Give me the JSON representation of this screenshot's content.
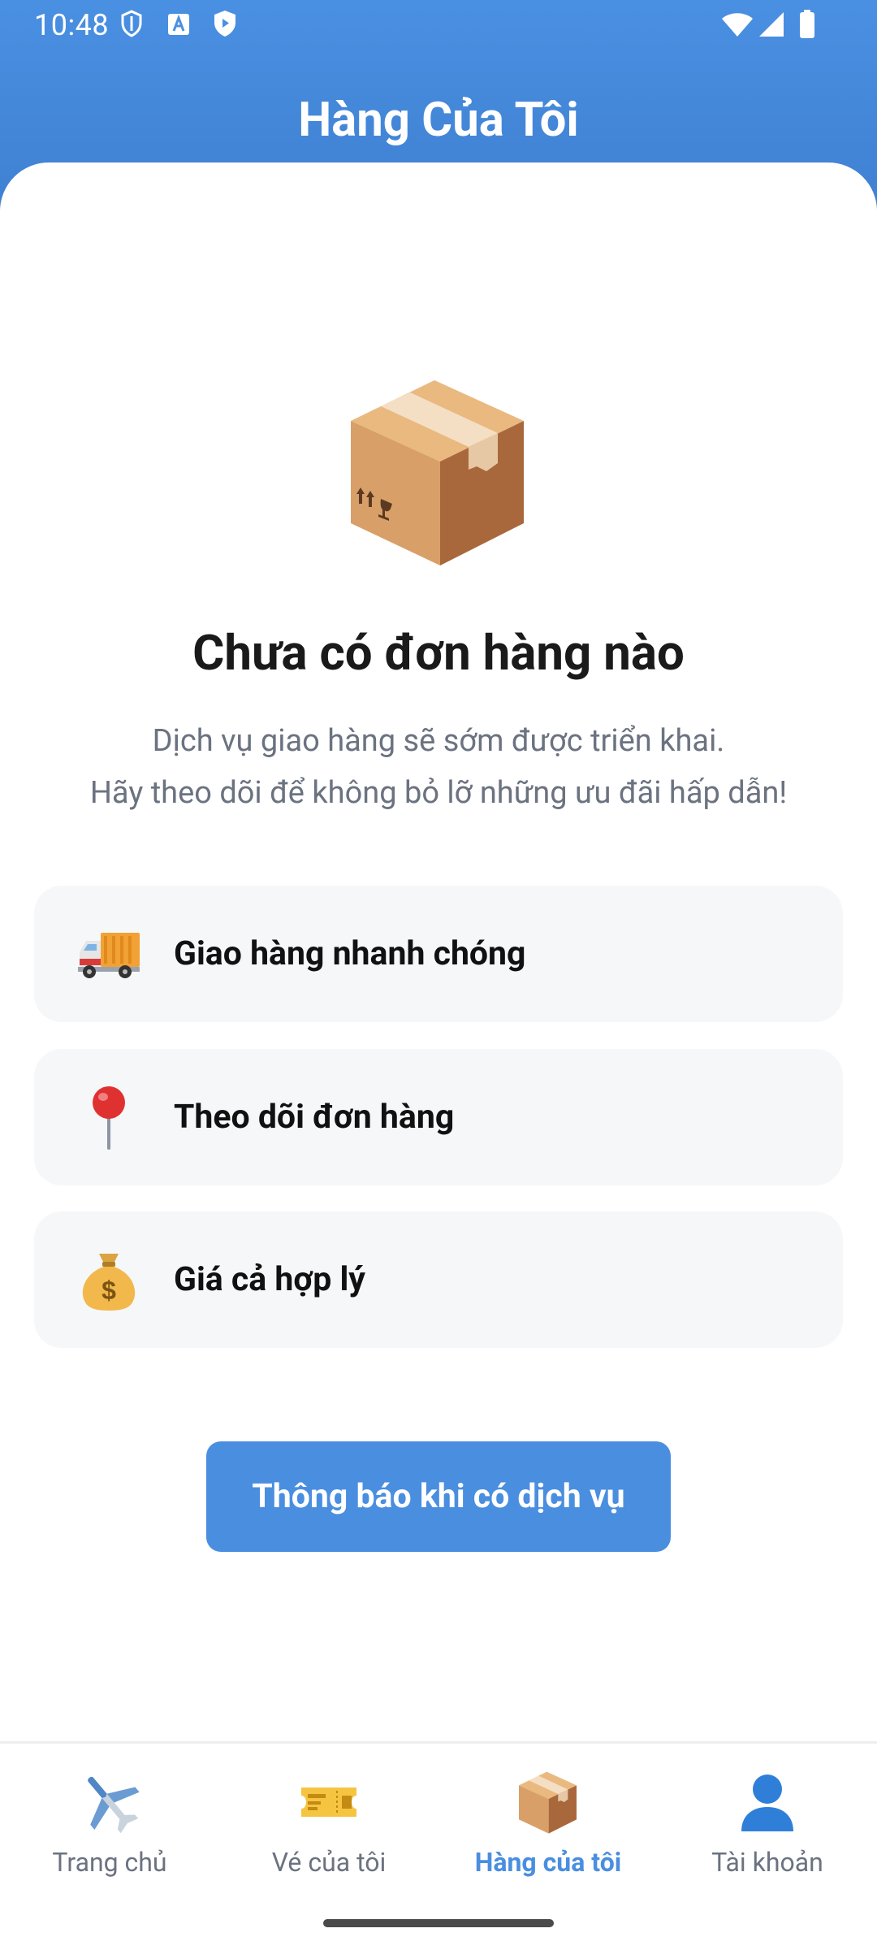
{
  "status_bar": {
    "time": "10:48"
  },
  "header": {
    "title": "Hàng Của Tôi"
  },
  "empty_state": {
    "title": "Chưa có đơn hàng nào",
    "description_line1": "Dịch vụ giao hàng sẽ sớm được triển khai.",
    "description_line2": "Hãy theo dõi để không bỏ lỡ những ưu đãi hấp dẫn!"
  },
  "features": [
    {
      "icon": "delivery-truck-icon",
      "label": "Giao hàng nhanh chóng"
    },
    {
      "icon": "location-pin-icon",
      "label": "Theo dõi đơn hàng"
    },
    {
      "icon": "money-bag-icon",
      "label": "Giá cả hợp lý"
    }
  ],
  "cta": {
    "label": "Thông báo khi có dịch vụ"
  },
  "bottom_nav": {
    "items": [
      {
        "icon": "airplane-icon",
        "label": "Trang chủ",
        "active": false
      },
      {
        "icon": "ticket-icon",
        "label": "Vé của tôi",
        "active": false
      },
      {
        "icon": "package-icon",
        "label": "Hàng của tôi",
        "active": true
      },
      {
        "icon": "user-icon",
        "label": "Tài khoản",
        "active": false
      }
    ]
  },
  "colors": {
    "primary": "#4a8ee0",
    "header_top": "#4a90e2",
    "card_background": "#f6f7f9",
    "text_dark": "#111111",
    "text_muted": "#6b7280"
  }
}
